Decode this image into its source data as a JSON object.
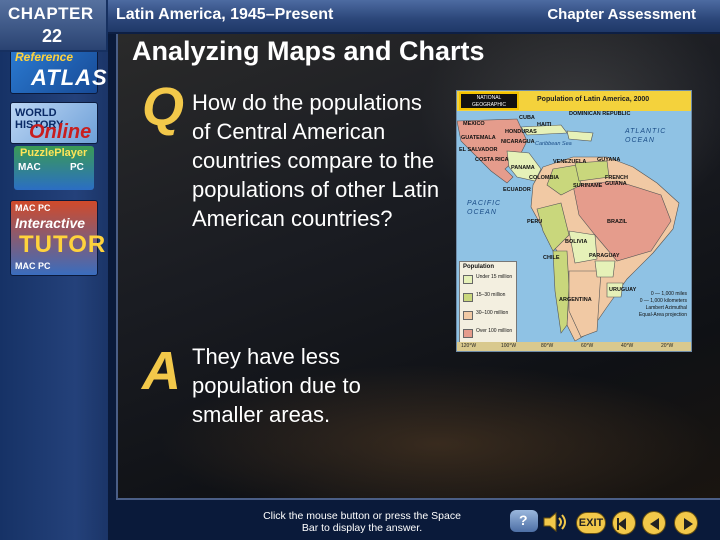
{
  "header": {
    "chapter_word": "CHAPTER",
    "chapter_number": "22",
    "chapter_title": "Latin America, 1945–Present",
    "section_label": "Chapter Assessment"
  },
  "sidebar": {
    "reference_atlas": {
      "line1": "Reference",
      "line2": "ATLAS"
    },
    "world_history_online": {
      "line1": "WORLD",
      "line2": "HISTORY",
      "line3": "Online"
    },
    "puzzle_player": {
      "title": "PuzzlePlayer",
      "mac": "MAC",
      "pc": "PC"
    },
    "interactive_tutor": {
      "line1": "MAC     PC",
      "line2": "Interactive",
      "line3": "TUTOR",
      "line4": "MAC     PC"
    }
  },
  "slide": {
    "heading": "Analyzing Maps and Charts",
    "q_letter": "Q",
    "question": "How do the populations of Central American countries compare to the populations of other Latin American countries?",
    "a_letter": "A",
    "answer": "They have less population due to smaller areas."
  },
  "map": {
    "publisher": "NATIONAL GEOGRAPHIC",
    "title": "Population of Latin America, 2000",
    "countries": [
      "MEXICO",
      "CUBA",
      "DOMINICAN REPUBLIC",
      "HAITI",
      "HONDURAS",
      "GUATEMALA",
      "EL SALVADOR",
      "NICARAGUA",
      "COSTA RICA",
      "PANAMA",
      "VENEZUELA",
      "GUYANA",
      "COLOMBIA",
      "SURINAME",
      "FRENCH GUIANA",
      "ECUADOR",
      "PERU",
      "BRAZIL",
      "BOLIVIA",
      "PARAGUAY",
      "CHILE",
      "URUGUAY",
      "ARGENTINA"
    ],
    "oceans": {
      "atlantic": "ATLANTIC OCEAN",
      "pacific": "PACIFIC OCEAN",
      "caribbean": "Caribbean Sea"
    },
    "legend_title": "Population",
    "legend": [
      {
        "label": "Under 15 million",
        "color": "#e6f1b8"
      },
      {
        "label": "15–30 million",
        "color": "#c9d77c"
      },
      {
        "label": "30–100 million",
        "color": "#f1c9a4"
      },
      {
        "label": "Over 100 million",
        "color": "#e59c8c"
      }
    ],
    "scale": "0 — 1,000 miles\n0 — 1,000 kilometers\nLambert Azimuthal\nEqual-Area projection",
    "longitudes": [
      "120°W",
      "100°W",
      "80°W",
      "60°W",
      "40°W",
      "20°W"
    ]
  },
  "footer": {
    "hint": "Click the mouse button or press the Space Bar to display the answer.",
    "help": "?",
    "exit": "EXIT"
  }
}
